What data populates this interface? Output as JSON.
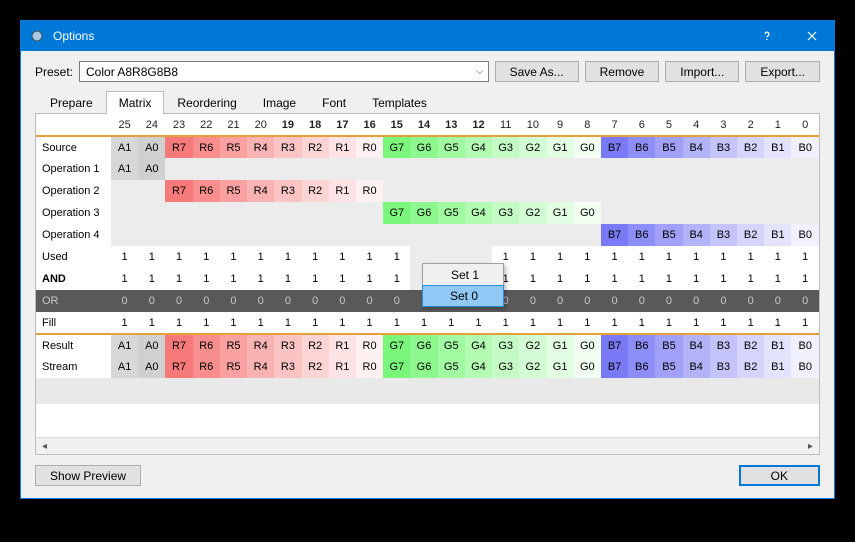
{
  "titlebar": {
    "title": "Options"
  },
  "preset": {
    "label": "Preset:",
    "value": "Color A8R8G8B8",
    "save_as": "Save As...",
    "remove": "Remove",
    "import": "Import...",
    "export": "Export..."
  },
  "tabs": {
    "prepare": "Prepare",
    "matrix": "Matrix",
    "reordering": "Reordering",
    "image": "Image",
    "font": "Font",
    "templates": "Templates",
    "active": "Matrix"
  },
  "cols": [
    "25",
    "24",
    "23",
    "22",
    "21",
    "20",
    "19",
    "18",
    "17",
    "16",
    "15",
    "14",
    "13",
    "12",
    "11",
    "10",
    "9",
    "8",
    "7",
    "6",
    "5",
    "4",
    "3",
    "2",
    "1",
    "0"
  ],
  "cols_bold": {
    "19": true,
    "18": true,
    "17": true,
    "16": true,
    "15": true,
    "14": true,
    "13": true,
    "12": true
  },
  "rows": {
    "source": {
      "label": "Source",
      "cells": [
        "A1",
        "A0",
        "R7",
        "R6",
        "R5",
        "R4",
        "R3",
        "R2",
        "R1",
        "R0",
        "G7",
        "G6",
        "G5",
        "G4",
        "G3",
        "G2",
        "G1",
        "G0",
        "B7",
        "B6",
        "B5",
        "B4",
        "B3",
        "B2",
        "B1",
        "B0"
      ]
    },
    "op1": {
      "label": "Operation 1",
      "cells": [
        "A1",
        "A0",
        "",
        "",
        "",
        "",
        "",
        "",
        "",
        "",
        "",
        "",
        "",
        "",
        "",
        "",
        "",
        "",
        "",
        "",
        "",
        "",
        "",
        "",
        "",
        ""
      ]
    },
    "op2": {
      "label": "Operation 2",
      "cells": [
        "",
        "",
        "R7",
        "R6",
        "R5",
        "R4",
        "R3",
        "R2",
        "R1",
        "R0",
        "",
        "",
        "",
        "",
        "",
        "",
        "",
        "",
        "",
        "",
        "",
        "",
        "",
        "",
        "",
        ""
      ]
    },
    "op3": {
      "label": "Operation 3",
      "cells": [
        "",
        "",
        "",
        "",
        "",
        "",
        "",
        "",
        "",
        "",
        "G7",
        "G6",
        "G5",
        "G4",
        "G3",
        "G2",
        "G1",
        "G0",
        "",
        "",
        "",
        "",
        "",
        "",
        "",
        ""
      ]
    },
    "op4": {
      "label": "Operation 4",
      "cells": [
        "",
        "",
        "",
        "",
        "",
        "",
        "",
        "",
        "",
        "",
        "",
        "",
        "",
        "",
        "",
        "",
        "",
        "",
        "B7",
        "B6",
        "B5",
        "B4",
        "B3",
        "B2",
        "B1",
        "B0"
      ]
    },
    "used": {
      "label": "Used",
      "cells": [
        "1",
        "1",
        "1",
        "1",
        "1",
        "1",
        "1",
        "1",
        "1",
        "1",
        "1",
        "",
        "",
        "",
        "1",
        "1",
        "1",
        "1",
        "1",
        "1",
        "1",
        "1",
        "1",
        "1",
        "1",
        "1"
      ]
    },
    "and": {
      "label": "AND",
      "cells": [
        "1",
        "1",
        "1",
        "1",
        "1",
        "1",
        "1",
        "1",
        "1",
        "1",
        "1",
        "",
        "",
        "",
        "1",
        "1",
        "1",
        "1",
        "1",
        "1",
        "1",
        "1",
        "1",
        "1",
        "1",
        "1"
      ]
    },
    "or": {
      "label": "OR",
      "cells": [
        "0",
        "0",
        "0",
        "0",
        "0",
        "0",
        "0",
        "0",
        "0",
        "0",
        "0",
        "",
        "",
        "",
        "0",
        "0",
        "0",
        "0",
        "0",
        "0",
        "0",
        "0",
        "0",
        "0",
        "0",
        "0"
      ]
    },
    "fill": {
      "label": "Fill",
      "cells": [
        "1",
        "1",
        "1",
        "1",
        "1",
        "1",
        "1",
        "1",
        "1",
        "1",
        "1",
        "1",
        "1",
        "1",
        "1",
        "1",
        "1",
        "1",
        "1",
        "1",
        "1",
        "1",
        "1",
        "1",
        "1",
        "1"
      ]
    },
    "result": {
      "label": "Result",
      "cells": [
        "A1",
        "A0",
        "R7",
        "R6",
        "R5",
        "R4",
        "R3",
        "R2",
        "R1",
        "R0",
        "G7",
        "G6",
        "G5",
        "G4",
        "G3",
        "G2",
        "G1",
        "G0",
        "B7",
        "B6",
        "B5",
        "B4",
        "B3",
        "B2",
        "B1",
        "B0"
      ]
    },
    "stream": {
      "label": "Stream",
      "cells": [
        "A1",
        "A0",
        "R7",
        "R6",
        "R5",
        "R4",
        "R3",
        "R2",
        "R1",
        "R0",
        "G7",
        "G6",
        "G5",
        "G4",
        "G3",
        "G2",
        "G1",
        "G0",
        "B7",
        "B6",
        "B5",
        "B4",
        "B3",
        "B2",
        "B1",
        "B0"
      ]
    }
  },
  "row_order": [
    "source",
    "op1",
    "op2",
    "op3",
    "op4",
    "used",
    "and",
    "or",
    "fill",
    "result",
    "stream"
  ],
  "bold_rows": {
    "and": true
  },
  "sep_rows": {
    "source": true,
    "result": true
  },
  "or_row_bg": "#595959",
  "or_row_fg": "#c8c8c8",
  "colors": {
    "A": [
      "#d7d7d7",
      "#d0d0d0"
    ],
    "R": [
      "#f77a7a",
      "#f88e8e",
      "#f9a1a1",
      "#fab3b3",
      "#fbc4c4",
      "#fcd4d4",
      "#fde3e3",
      "#fef1f1"
    ],
    "G": [
      "#7af77a",
      "#8ef88e",
      "#a1f9a1",
      "#b3fab3",
      "#c4fbc4",
      "#d4fcd4",
      "#e3fde3",
      "#f1fef1"
    ],
    "B": [
      "#7a7af7",
      "#8e8ef8",
      "#a1a1f9",
      "#b3b3fa",
      "#c4c4fb",
      "#d4d4fc",
      "#e3e3fd",
      "#f1f1fe"
    ]
  },
  "context_menu": {
    "items": [
      "Set 1",
      "Set 0"
    ],
    "highlighted": 1
  },
  "footer": {
    "show_preview": "Show Preview",
    "ok": "OK"
  }
}
